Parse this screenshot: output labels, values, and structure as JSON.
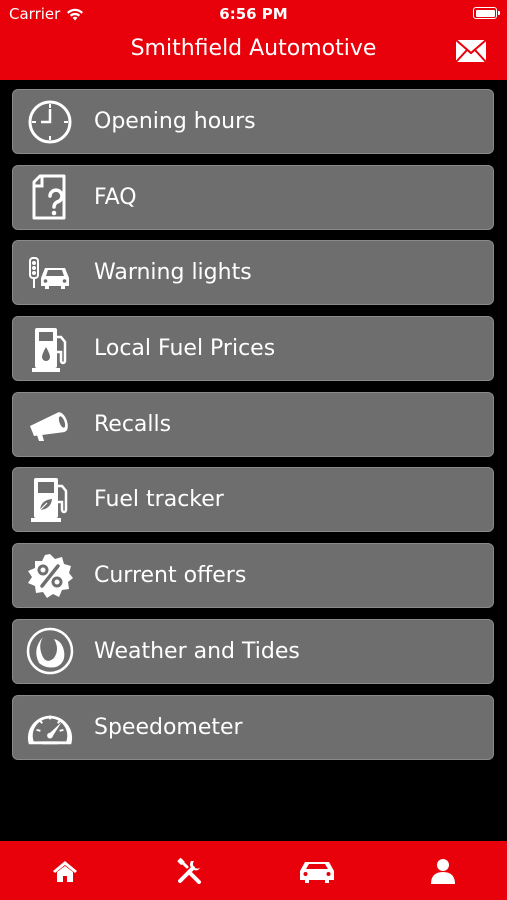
{
  "status_bar": {
    "carrier": "Carrier",
    "time": "6:56 PM"
  },
  "header": {
    "title": "Smithfield Automotive",
    "mail_icon": "envelope-icon"
  },
  "colors": {
    "brand_red": "#e8000b",
    "item_bg": "#6e6e6e",
    "background": "#000000"
  },
  "menu": {
    "items": [
      {
        "label": "Opening hours",
        "icon": "clock-icon"
      },
      {
        "label": "FAQ",
        "icon": "faq-document-icon"
      },
      {
        "label": "Warning lights",
        "icon": "traffic-light-car-icon"
      },
      {
        "label": "Local Fuel Prices",
        "icon": "fuel-pump-icon"
      },
      {
        "label": "Recalls",
        "icon": "megaphone-icon"
      },
      {
        "label": "Fuel tracker",
        "icon": "fuel-tracker-icon"
      },
      {
        "label": "Current offers",
        "icon": "percent-badge-icon"
      },
      {
        "label": "Weather and Tides",
        "icon": "weather-icon"
      },
      {
        "label": "Speedometer",
        "icon": "speedometer-icon"
      }
    ]
  },
  "tab_bar": {
    "tabs": [
      {
        "icon": "home-icon"
      },
      {
        "icon": "tools-icon"
      },
      {
        "icon": "car-icon"
      },
      {
        "icon": "profile-icon"
      }
    ]
  }
}
